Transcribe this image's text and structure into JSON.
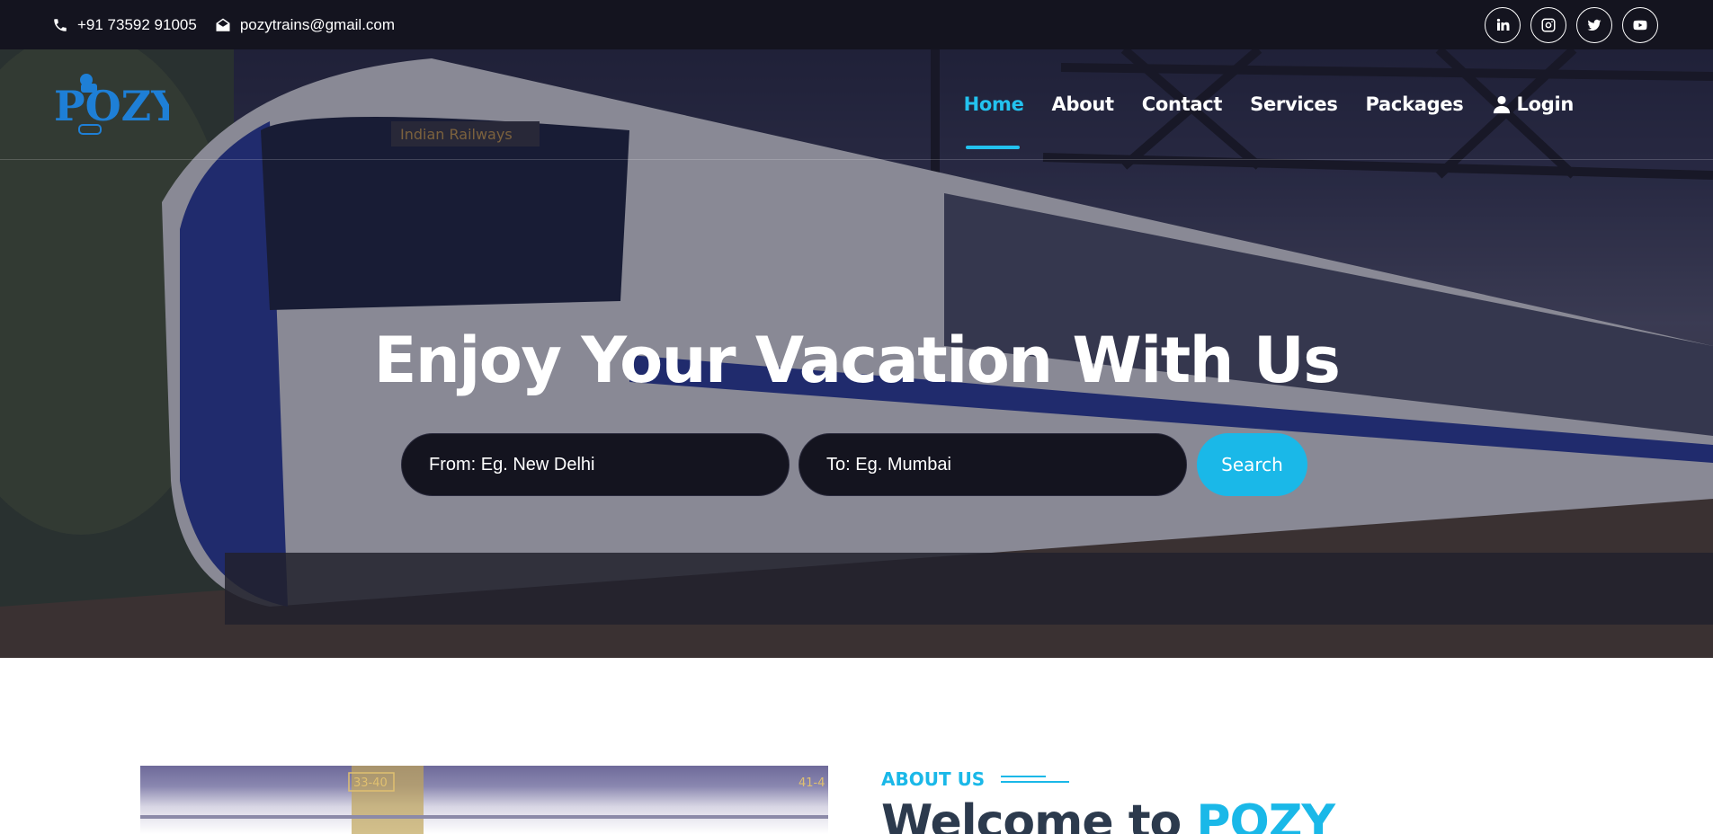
{
  "topbar": {
    "phone": "+91 73592 91005",
    "email": "pozytrains@gmail.com",
    "socials": [
      {
        "icon": "linkedin-icon"
      },
      {
        "icon": "instagram-icon"
      },
      {
        "icon": "twitter-icon"
      },
      {
        "icon": "youtube-icon"
      }
    ]
  },
  "brand": {
    "logo_text": "POZY",
    "logo_color": "#1e7fd6"
  },
  "nav": {
    "items": [
      {
        "label": "Home",
        "active": true
      },
      {
        "label": "About"
      },
      {
        "label": "Contact"
      },
      {
        "label": "Services"
      },
      {
        "label": "Packages"
      },
      {
        "label": "Login",
        "icon": "user-icon"
      }
    ]
  },
  "hero": {
    "title": "Enjoy Your Vacation With Us",
    "banner_text": "Indian Railways",
    "from_placeholder": "From: Eg. New Delhi",
    "to_placeholder": "To: Eg. Mumbai",
    "search_label": "Search"
  },
  "about": {
    "tag": "ABOUT US",
    "title_prefix": "Welcome to ",
    "title_brand": "POZY",
    "image_labels": [
      "33-40",
      "41-4"
    ]
  },
  "colors": {
    "accent": "#1ab8e8",
    "topbar_bg": "#14141f",
    "heading": "#2c3a4d"
  }
}
